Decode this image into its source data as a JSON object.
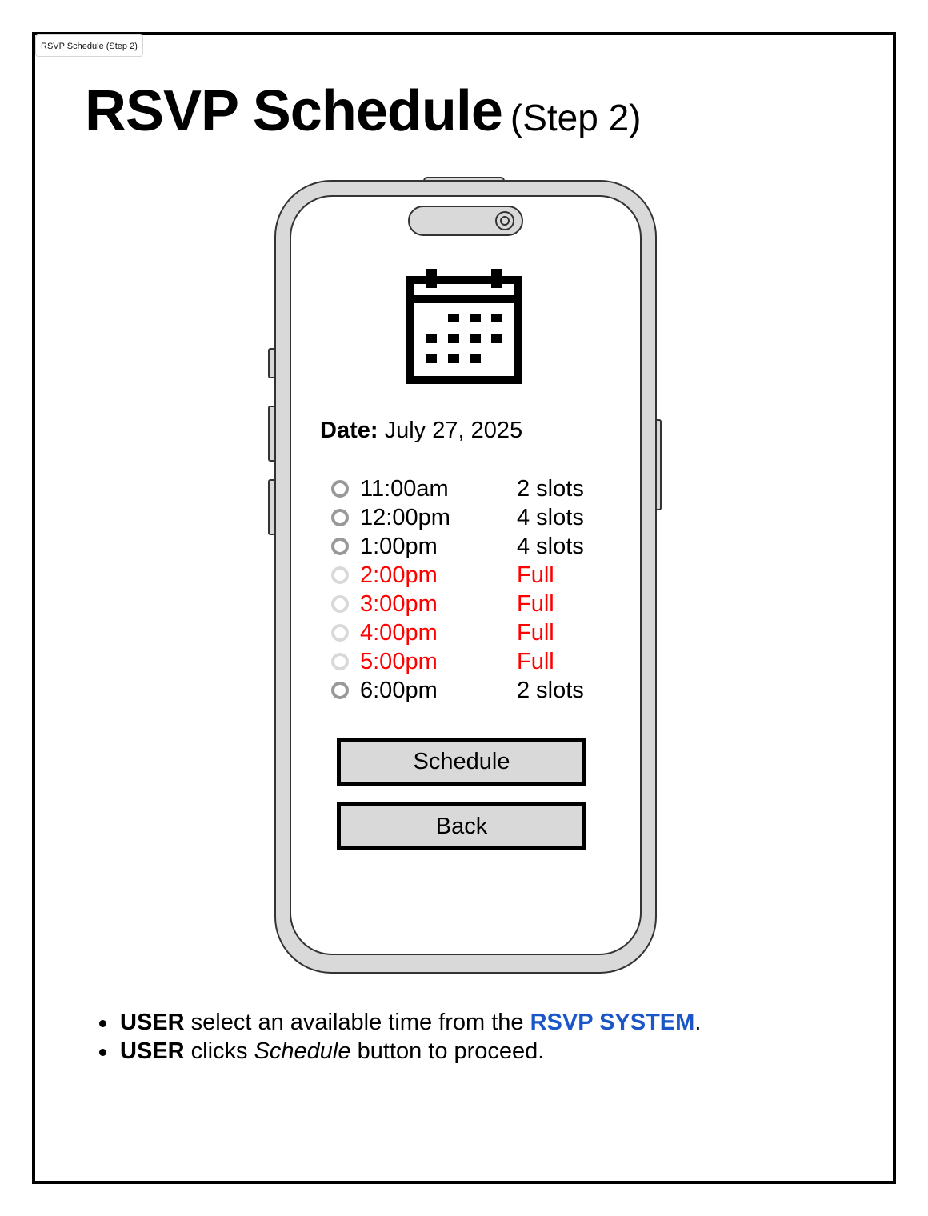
{
  "page_tab": "RSVP Schedule (Step 2)",
  "heading": {
    "main": "RSVP Schedule",
    "sub": "(Step 2)"
  },
  "icons": {
    "calendar": "calendar-icon",
    "camera": "camera-icon"
  },
  "date": {
    "label": "Date:",
    "value": "July 27, 2025"
  },
  "slots": [
    {
      "time": "11:00am",
      "availability": "2 slots",
      "full": false
    },
    {
      "time": "12:00pm",
      "availability": "4 slots",
      "full": false
    },
    {
      "time": "1:00pm",
      "availability": "4 slots",
      "full": false
    },
    {
      "time": "2:00pm",
      "availability": "Full",
      "full": true
    },
    {
      "time": "3:00pm",
      "availability": "Full",
      "full": true
    },
    {
      "time": "4:00pm",
      "availability": "Full",
      "full": true
    },
    {
      "time": "5:00pm",
      "availability": "Full",
      "full": true
    },
    {
      "time": "6:00pm",
      "availability": "2 slots",
      "full": false
    }
  ],
  "buttons": {
    "schedule": "Schedule",
    "back": "Back"
  },
  "notes": [
    {
      "actor": "USER",
      "text1": " select an available time from the ",
      "system": "RSVP SYSTEM",
      "text2": "."
    },
    {
      "actor": "USER",
      "text1": " clicks ",
      "emphasis": "Schedule",
      "text2": " button to proceed."
    }
  ],
  "colors": {
    "full": "#ff0000",
    "system": "#1a56c8",
    "button_bg": "#d9d9d9",
    "phone_body": "#d9d9d9"
  }
}
